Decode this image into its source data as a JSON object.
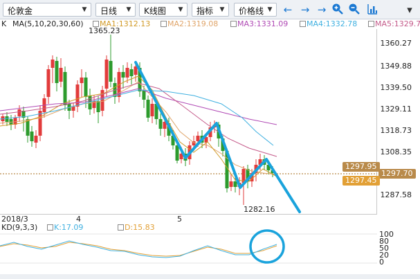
{
  "toolbar": {
    "instrument": "伦敦金",
    "period": "日线",
    "chart_type": "K线图",
    "indicator": "指标",
    "line_type": "价格线",
    "icons": [
      "back-arrow-icon",
      "forward-arrow-icon",
      "zoom-in-icon",
      "zoom-out-icon",
      "bar-chart-icon"
    ]
  },
  "legend": {
    "k_label": "K",
    "ma_label": "MA(5,10,20,30,60)",
    "ma1": "MA1:1312.13",
    "ma2": "MA2:1319.08",
    "ma3": "MA3:1331.09",
    "ma4": "MA4:1332.78",
    "ma5": "MA5:1329.7"
  },
  "kd_legend": {
    "title": "KD(9,3,3)",
    "k": "K:17.09",
    "d": "D:15.83"
  },
  "price_axis": [
    "1360.27",
    "1349.88",
    "1339.50",
    "1329.11",
    "1318.73",
    "1308.35",
    "1297.95",
    "1297.70",
    "1297.45",
    "1287.58"
  ],
  "kd_axis": [
    "100",
    "80",
    "50",
    "20",
    "0"
  ],
  "annotations": {
    "high": "1365.23",
    "low": "1282.16"
  },
  "dates": [
    "2018/3",
    "4",
    "5"
  ],
  "colors": {
    "up": "#e23b3b",
    "down": "#2d9b2d",
    "ma1": "#d19a26",
    "ma2": "#e0a56a",
    "ma3": "#b04ab5",
    "ma4": "#3fb0e0",
    "ma5": "#c45a8a",
    "drawn": "#1aa3dc",
    "tag_brown": "#b98a4a",
    "tag_orange": "#e2a036"
  }
}
